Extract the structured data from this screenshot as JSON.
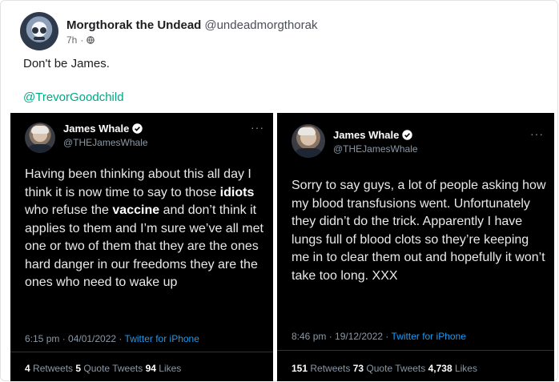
{
  "post": {
    "author_name": "Morgthorak the Undead",
    "author_handle": "@undeadmorgthorak",
    "time": "7h",
    "separator": "·",
    "text": "Don't be James.",
    "mention": "@TrevorGoodchild"
  },
  "tweets": [
    {
      "name": "James Whale",
      "handle": "@THEJamesWhale",
      "more": "···",
      "body_html": "Having been thinking about this all day I think it is now time to say to those <b>idiots</b> who refuse the <b>vaccine</b> and don’t think it applies to them and I’m sure we’ve all met one or two of them that they are the ones hard danger in our freedoms they are the ones who need to wake up",
      "time": "6:15 pm · 04/01/2022 · ",
      "source": "Twitter for iPhone",
      "retweets": "4",
      "retweets_label": " Retweets ",
      "quotes": "5",
      "quotes_label": " Quote Tweets ",
      "likes": "94",
      "likes_label": " Likes"
    },
    {
      "name": "James Whale",
      "handle": "@THEJamesWhale",
      "more": "···",
      "body_html": "Sorry to say guys, a lot of people asking how my blood transfusions went. Unfortunately they didn’t do the trick. Apparently I have lungs full of blood clots so they’re keeping me in to clear them out and hopefully it won’t take too long. XXX",
      "time": "8:46 pm · 19/12/2022 · ",
      "source": "Twitter for iPhone",
      "retweets": "151",
      "retweets_label": " Retweets ",
      "quotes": "73",
      "quotes_label": " Quote Tweets ",
      "likes": "4,738",
      "likes_label": " Likes"
    }
  ],
  "colors": {
    "mention": "#00a884",
    "tweet_bg": "#000000",
    "tweet_link": "#1d9bf0",
    "verified": "#1d9bf0"
  },
  "icons": [
    "globe-icon",
    "verified-badge-icon",
    "more-options-icon"
  ]
}
